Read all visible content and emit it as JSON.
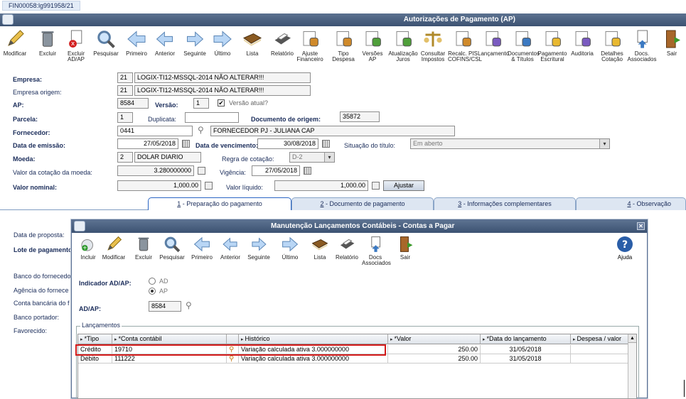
{
  "top_tab": "FIN00058:lg991958/21",
  "window_title": "Autorizações de Pagamento (AP)",
  "toolbar": [
    {
      "l1": "Modificar",
      "l2": "",
      "icon": "pencil-icon"
    },
    {
      "l1": "Excluir",
      "l2": "",
      "icon": "trash-icon"
    },
    {
      "l1": "Excluir",
      "l2": "AD/AP",
      "icon": "delete-doc-icon"
    },
    {
      "l1": "Pesquisar",
      "l2": "",
      "icon": "magnifier-icon"
    },
    {
      "l1": "Primeiro",
      "l2": "",
      "icon": "first-arrow-icon"
    },
    {
      "l1": "Anterior",
      "l2": "",
      "icon": "prev-arrow-icon"
    },
    {
      "l1": "Seguinte",
      "l2": "",
      "icon": "next-arrow-icon"
    },
    {
      "l1": "Último",
      "l2": "",
      "icon": "last-arrow-icon"
    },
    {
      "l1": "Lista",
      "l2": "",
      "icon": "book-icon"
    },
    {
      "l1": "Relatório",
      "l2": "",
      "icon": "printer-icon"
    },
    {
      "l1": "Ajuste",
      "l2": "Financeiro",
      "icon": "money-adjust-icon"
    },
    {
      "l1": "Tipo",
      "l2": "Despesa",
      "icon": "expense-type-icon"
    },
    {
      "l1": "Versões",
      "l2": "AP",
      "icon": "versions-icon"
    },
    {
      "l1": "Atualização",
      "l2": "Juros",
      "icon": "interest-icon"
    },
    {
      "l1": "Consultar",
      "l2": "Impostos",
      "icon": "scale-icon"
    },
    {
      "l1": "Recalc. PIS",
      "l2": "COFINS/CSL",
      "icon": "recalc-icon"
    },
    {
      "l1": "Lançamento",
      "l2": "",
      "icon": "entry-icon"
    },
    {
      "l1": "Documentos",
      "l2": "& Títulos",
      "icon": "documents-icon"
    },
    {
      "l1": "Pagamento",
      "l2": "Escritural",
      "icon": "payment-icon"
    },
    {
      "l1": "Auditoria",
      "l2": "",
      "icon": "audit-icon"
    },
    {
      "l1": "Detalhes",
      "l2": "Cotação",
      "icon": "quote-details-icon"
    },
    {
      "l1": "Docs.",
      "l2": "Associados",
      "icon": "docs-associated-icon"
    },
    {
      "l1": "Sair",
      "l2": "",
      "icon": "exit-door-icon"
    }
  ],
  "form": {
    "empresa_label": "Empresa:",
    "empresa_code": "21",
    "empresa_name": "LOGIX-TI12-MSSQL-2014 NÃO ALTERAR!!!",
    "empresa_origem_label": "Empresa origem:",
    "empresa_origem_code": "21",
    "empresa_origem_name": "LOGIX-TI12-MSSQL-2014 NÃO ALTERAR!!!",
    "ap_label": "AP:",
    "ap_value": "8584",
    "versao_label": "Versão:",
    "versao_value": "1",
    "versao_atual_label": "Versão atual?",
    "versao_atual_checked": "✔",
    "parcela_label": "Parcela:",
    "parcela_value": "1",
    "duplicata_label": "Duplicata:",
    "duplicata_value": "",
    "doc_origem_label": "Documento de origem:",
    "doc_origem_value": "35872",
    "fornecedor_label": "Fornecedor:",
    "fornecedor_code": "0441",
    "fornecedor_name": "FORNECEDOR PJ - JULIANA CAP",
    "emissao_label": "Data de emissão:",
    "emissao_value": "27/05/2018",
    "vencimento_label": "Data de vencimento:",
    "vencimento_value": "30/08/2018",
    "situacao_label": "Situação do título:",
    "situacao_value": "Em aberto",
    "moeda_label": "Moeda:",
    "moeda_code": "2",
    "moeda_name": "DOLAR DIARIO",
    "regra_label": "Regra de cotação:",
    "regra_value": "D-2",
    "valor_cotacao_label": "Valor da cotação da moeda:",
    "valor_cotacao_value": "3.280000000",
    "vigencia_label": "Vigência:",
    "vigencia_value": "27/05/2018",
    "valor_nominal_label": "Valor nominal:",
    "valor_nominal_value": "1,000.00",
    "valor_liquido_label": "Valor líquido:",
    "valor_liquido_value": "1,000.00",
    "ajustar_label": "Ajustar"
  },
  "tabs": [
    {
      "num": "1",
      "label": " - Preparação do pagamento"
    },
    {
      "num": "2",
      "label": " - Documento de pagamento"
    },
    {
      "num": "3",
      "label": " - Informações complementares"
    },
    {
      "num": "4",
      "label": " - Observação"
    }
  ],
  "lower": {
    "data_proposta": "Data de proposta:",
    "lote_pagamento": "Lote de pagamento",
    "banco_fornecedor": "Banco do fornecedo",
    "agencia_fornecedor": "Agência do fornece",
    "conta_bancaria": "Conta bancária do f",
    "banco_portador": "Banco portador:",
    "favorecido": "Favorecido:"
  },
  "modal": {
    "title": "Manutenção Lançamentos Contábeis - Contas a Pagar",
    "toolbar": [
      {
        "l1": "Incluir",
        "l2": "",
        "icon": "add-icon"
      },
      {
        "l1": "Modificar",
        "l2": "",
        "icon": "pencil-icon"
      },
      {
        "l1": "Excluir",
        "l2": "",
        "icon": "trash-icon"
      },
      {
        "l1": "Pesquisar",
        "l2": "",
        "icon": "magnifier-icon"
      },
      {
        "l1": "Primeiro",
        "l2": "",
        "icon": "first-arrow-icon"
      },
      {
        "l1": "Anterior",
        "l2": "",
        "icon": "prev-arrow-icon"
      },
      {
        "l1": "Seguinte",
        "l2": "",
        "icon": "next-arrow-icon"
      },
      {
        "l1": "Último",
        "l2": "",
        "icon": "last-arrow-icon"
      },
      {
        "l1": "Lista",
        "l2": "",
        "icon": "book-icon"
      },
      {
        "l1": "Relatório",
        "l2": "",
        "icon": "printer-icon"
      },
      {
        "l1": "Docs",
        "l2": "Associados",
        "icon": "docs-associated-icon"
      },
      {
        "l1": "Sair",
        "l2": "",
        "icon": "exit-door-icon"
      }
    ],
    "help_label": "Ajuda",
    "indicador_label": "Indicador AD/AP:",
    "radio_ad": "AD",
    "radio_ap": "AP",
    "adap_label": "AD/AP:",
    "adap_value": "8584",
    "lancamentos_label": "Lançamentos",
    "columns": [
      "*Tipo",
      "*Conta contábil",
      "Histórico",
      "*Valor",
      "*Data do lançamento",
      "Despesa / valor"
    ],
    "rows": [
      {
        "tipo": "Crédito",
        "conta": "19710",
        "historico": "Variação calculada ativa 3.000000000",
        "valor": "250.00",
        "data": "31/05/2018",
        "despesa": ""
      },
      {
        "tipo": "Débito",
        "conta": "111222",
        "historico": "Variação calculada ativa 3.000000000",
        "valor": "250.00",
        "data": "31/05/2018",
        "despesa": ""
      }
    ]
  }
}
